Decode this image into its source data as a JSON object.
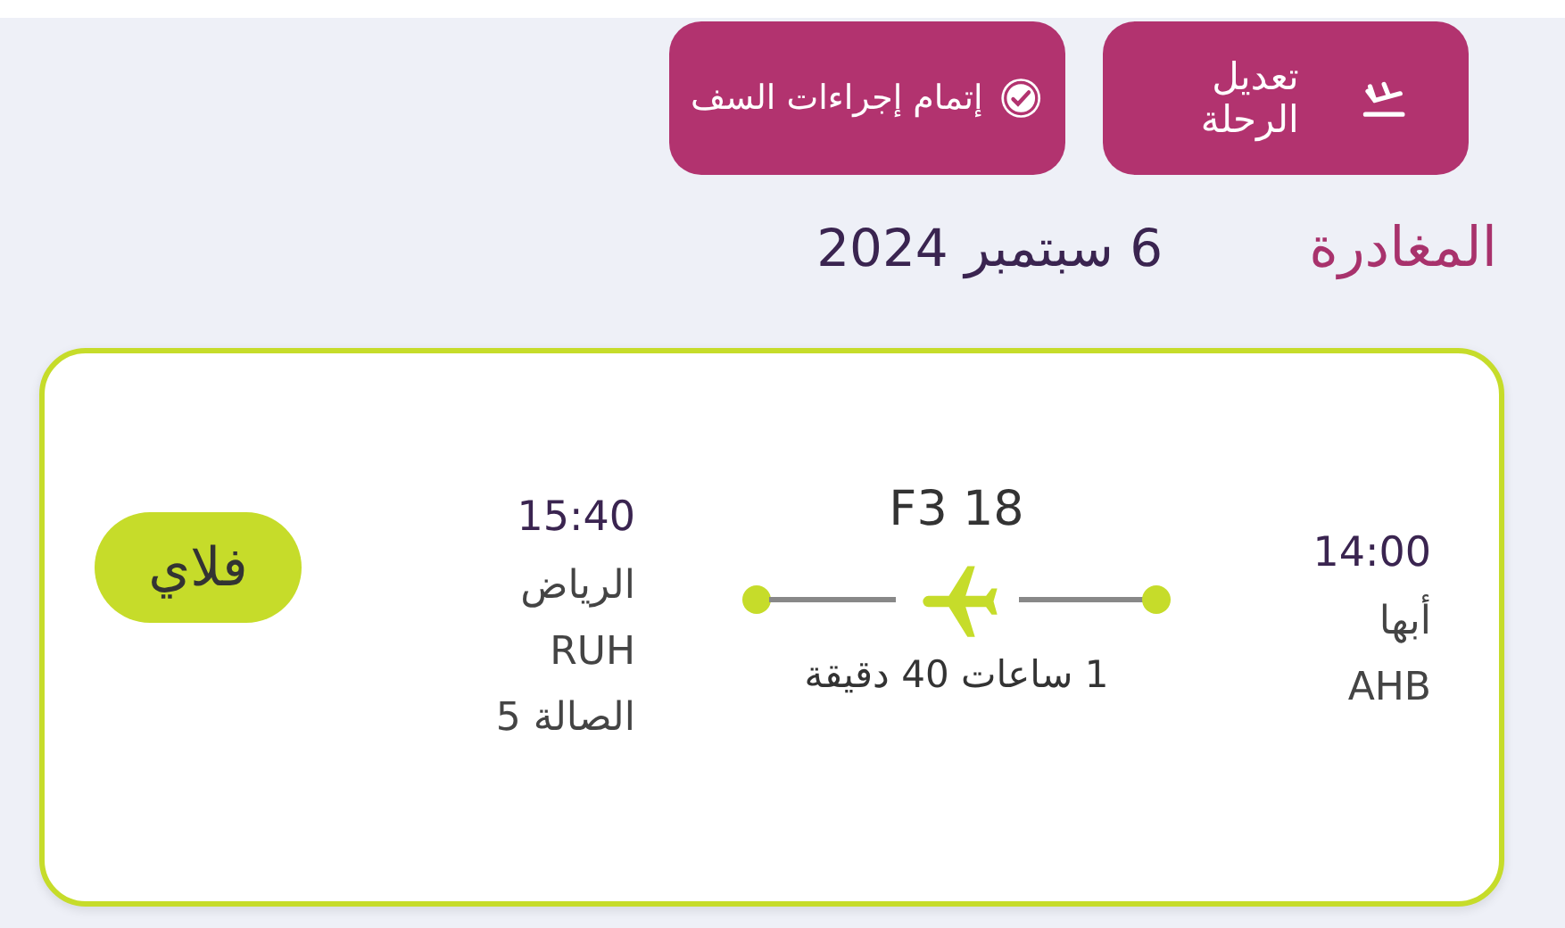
{
  "actions": [
    {
      "kind": "change",
      "label": "تعديل الرحلة"
    },
    {
      "kind": "checkin",
      "label": "إتمام إجراءات السف"
    }
  ],
  "header": {
    "title": "المغادرة",
    "date": "6 سبتمبر 2024"
  },
  "flight": {
    "departure": {
      "time": "14:00",
      "city": "أبها",
      "code": "AHB"
    },
    "flight_number": "F3 18",
    "duration": "1 ساعات 40 دقيقة",
    "arrival": {
      "time": "15:40",
      "city": "الرياض",
      "code": "RUH",
      "terminal": "الصالة 5"
    },
    "airline": "فلاي"
  }
}
